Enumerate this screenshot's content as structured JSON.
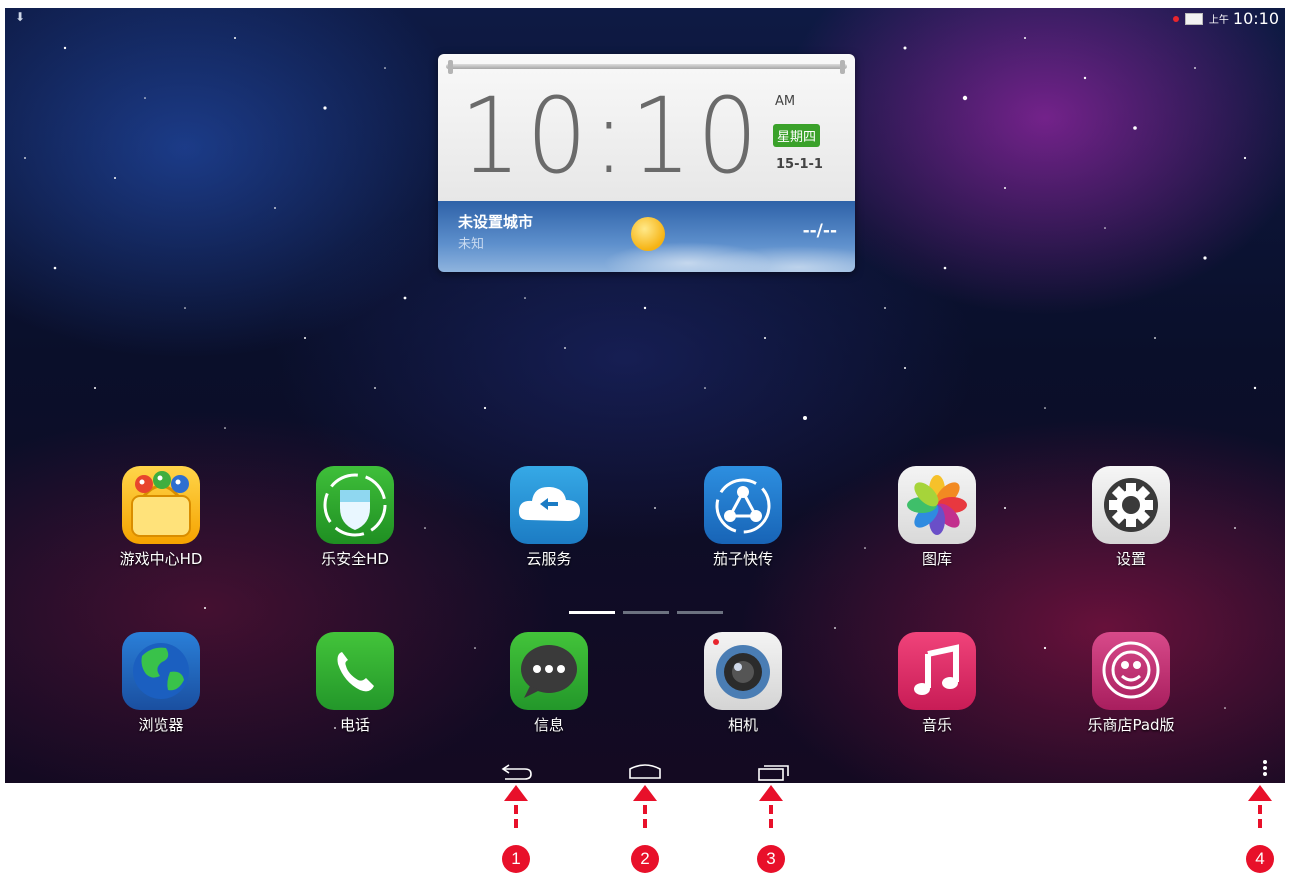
{
  "status_bar": {
    "notification_icon": "download-notification-icon",
    "time_prefix": "上午",
    "time": "10:10"
  },
  "clock_widget": {
    "time": "10:10",
    "ampm": "AM",
    "weekday": "星期四",
    "date": "15-1-1",
    "city": "未设置城市",
    "condition": "未知",
    "temperature": "--/--",
    "weather_icon": "sun-icon"
  },
  "apps_row1": [
    {
      "label": "游戏中心HD",
      "icon": "game-center-icon"
    },
    {
      "label": "乐安全HD",
      "icon": "security-shield-icon"
    },
    {
      "label": "云服务",
      "icon": "cloud-service-icon"
    },
    {
      "label": "茄子快传",
      "icon": "share-transfer-icon"
    },
    {
      "label": "图库",
      "icon": "gallery-icon"
    },
    {
      "label": "设置",
      "icon": "settings-gear-icon"
    }
  ],
  "apps_row2": [
    {
      "label": "浏览器",
      "icon": "browser-globe-icon"
    },
    {
      "label": "电话",
      "icon": "phone-icon"
    },
    {
      "label": "信息",
      "icon": "messages-icon"
    },
    {
      "label": "相机",
      "icon": "camera-icon"
    },
    {
      "label": "音乐",
      "icon": "music-icon"
    },
    {
      "label": "乐商店Pad版",
      "icon": "app-store-icon"
    }
  ],
  "page_indicator": {
    "pages": 3,
    "current": 1
  },
  "nav_bar": {
    "back": "back-icon",
    "home": "home-icon",
    "recents": "recent-apps-icon",
    "menu": "overflow-menu-icon"
  },
  "annotations": [
    "1",
    "2",
    "3",
    "4"
  ],
  "colors": {
    "annotation_red": "#e8102a",
    "weekday_green": "#3aa12a"
  }
}
